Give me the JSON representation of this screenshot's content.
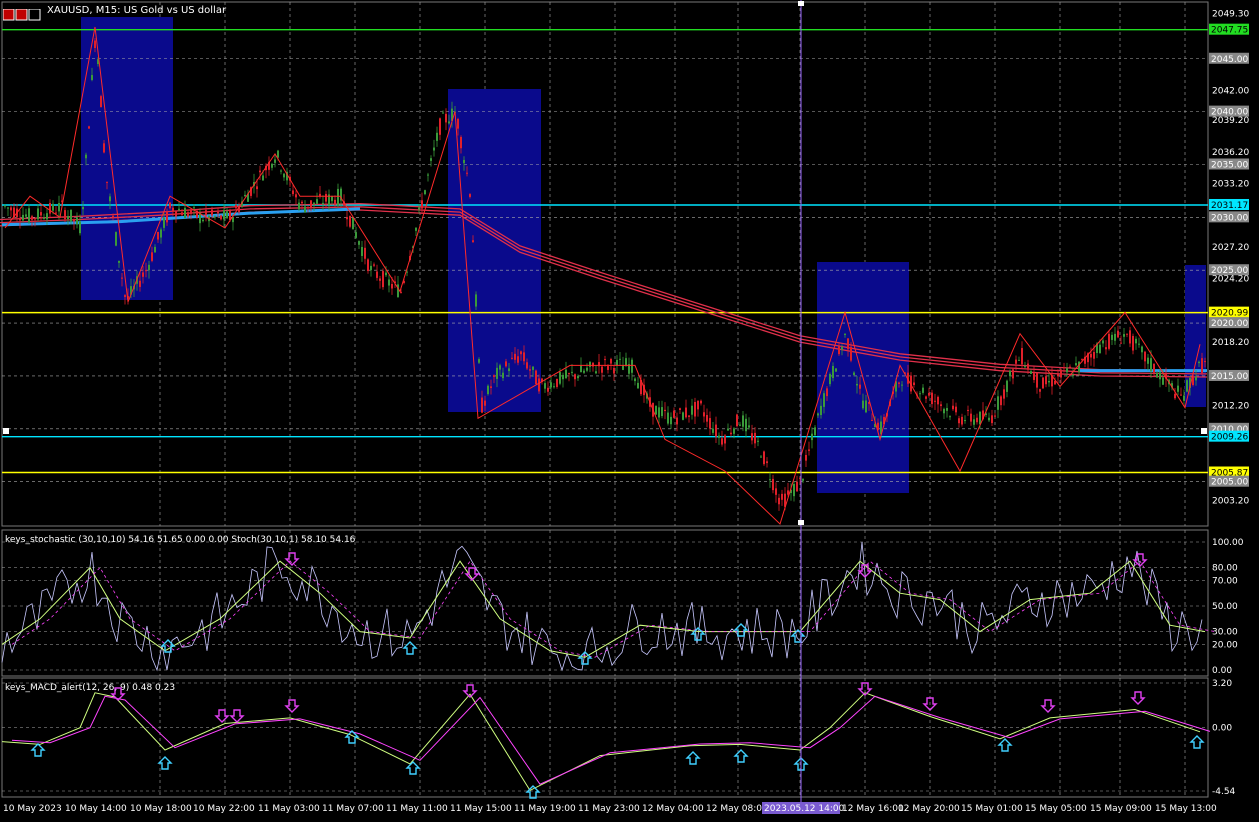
{
  "window": {
    "symbol_title": "XAUUSD, M15: US Gold vs US dollar"
  },
  "price_axis": {
    "ticks": [
      "2049.30",
      "2045.00",
      "2042.00",
      "2039.20",
      "2036.20",
      "2033.20",
      "2030.00",
      "2027.20",
      "2024.20",
      "2020.00",
      "2018.20",
      "2015.00",
      "2012.20",
      "2009.20",
      "2005.00",
      "2003.20"
    ],
    "tick_values": [
      2049.3,
      2045.0,
      2042.0,
      2039.2,
      2036.2,
      2033.2,
      2030.0,
      2027.2,
      2024.2,
      2020.0,
      2018.2,
      2015.0,
      2012.2,
      2009.2,
      2005.0,
      2003.2
    ],
    "min": 2001.0,
    "max": 2049.8
  },
  "level_lines": [
    {
      "label": "2047.75",
      "value": 2047.75,
      "color": "#22dd22",
      "text_color": "#000000"
    },
    {
      "label": "2045.00",
      "value": 2045.0,
      "color": "#888888",
      "text_color": "#ffffff"
    },
    {
      "label": "2040.00",
      "value": 2040.0,
      "color": "#888888",
      "text_color": "#ffffff"
    },
    {
      "label": "2035.00",
      "value": 2035.0,
      "color": "#888888",
      "text_color": "#ffffff"
    },
    {
      "label": "2031.17",
      "value": 2031.17,
      "color": "#00e5ff",
      "text_color": "#000000"
    },
    {
      "label": "2030.00",
      "value": 2030.0,
      "color": "#888888",
      "text_color": "#ffffff"
    },
    {
      "label": "2025.00",
      "value": 2025.0,
      "color": "#888888",
      "text_color": "#ffffff"
    },
    {
      "label": "2020.99",
      "value": 2020.99,
      "color": "#ffff00",
      "text_color": "#000000"
    },
    {
      "label": "2020.00",
      "value": 2020.0,
      "color": "#888888",
      "text_color": "#ffffff"
    },
    {
      "label": "2015.00",
      "value": 2015.0,
      "color": "#888888",
      "text_color": "#ffffff"
    },
    {
      "label": "2010.00",
      "value": 2010.0,
      "color": "#888888",
      "text_color": "#ffffff"
    },
    {
      "label": "2009.26",
      "value": 2009.26,
      "color": "#00e5ff",
      "text_color": "#000000"
    },
    {
      "label": "2005.87",
      "value": 2005.87,
      "color": "#ffff00",
      "text_color": "#000000"
    },
    {
      "label": "2005.00",
      "value": 2005.0,
      "color": "#888888",
      "text_color": "#ffffff"
    }
  ],
  "stochastic": {
    "label": "keys_stochastic (30,10,10) 54.16 51.65 0.00 0.00 Stoch(30,10,1) 58.10 54.16",
    "ticks": [
      "100.00",
      "80.00",
      "70.00",
      "50.00",
      "30.00",
      "20.00",
      "0.00"
    ],
    "tick_values": [
      100,
      80,
      70,
      50,
      30,
      20,
      0
    ]
  },
  "macd": {
    "label": "keys_MACD_alert(12, 26, 9) 0.48 0.23",
    "ticks": [
      "3.20",
      "0.00",
      "-4.54"
    ],
    "tick_values": [
      3.2,
      0,
      -4.54
    ]
  },
  "time_axis": {
    "labels": [
      "10 May 2023",
      "10 May 14:00",
      "10 May 18:00",
      "10 May 22:00",
      "11 May 03:00",
      "11 May 07:00",
      "11 May 11:00",
      "11 May 15:00",
      "11 May 19:00",
      "11 May 23:00",
      "12 May 04:00",
      "12 May 08:00",
      "12 May 16:00",
      "12 May 20:00",
      "15 May 01:00",
      "15 May 05:00",
      "15 May 09:00",
      "15 May 13:00"
    ],
    "crosshair_label": "2023.05.12 14:00"
  },
  "colors": {
    "background": "#000000",
    "bull_candle": "#3a9a3a",
    "bear_candle": "#e0202a",
    "zone": "#0a0a8c",
    "zigzag": "#ff2a2a",
    "ma_red": "#e0304a",
    "ma_blue": "#2aa0f0",
    "crosshair": "#9a66ff",
    "stoch_main": "#c8c8ff",
    "stoch_signal": "#d0ff80",
    "stoch_dash": "#ff44ff",
    "arrow_up": "#40d0ff",
    "arrow_down": "#e040f0"
  }
}
